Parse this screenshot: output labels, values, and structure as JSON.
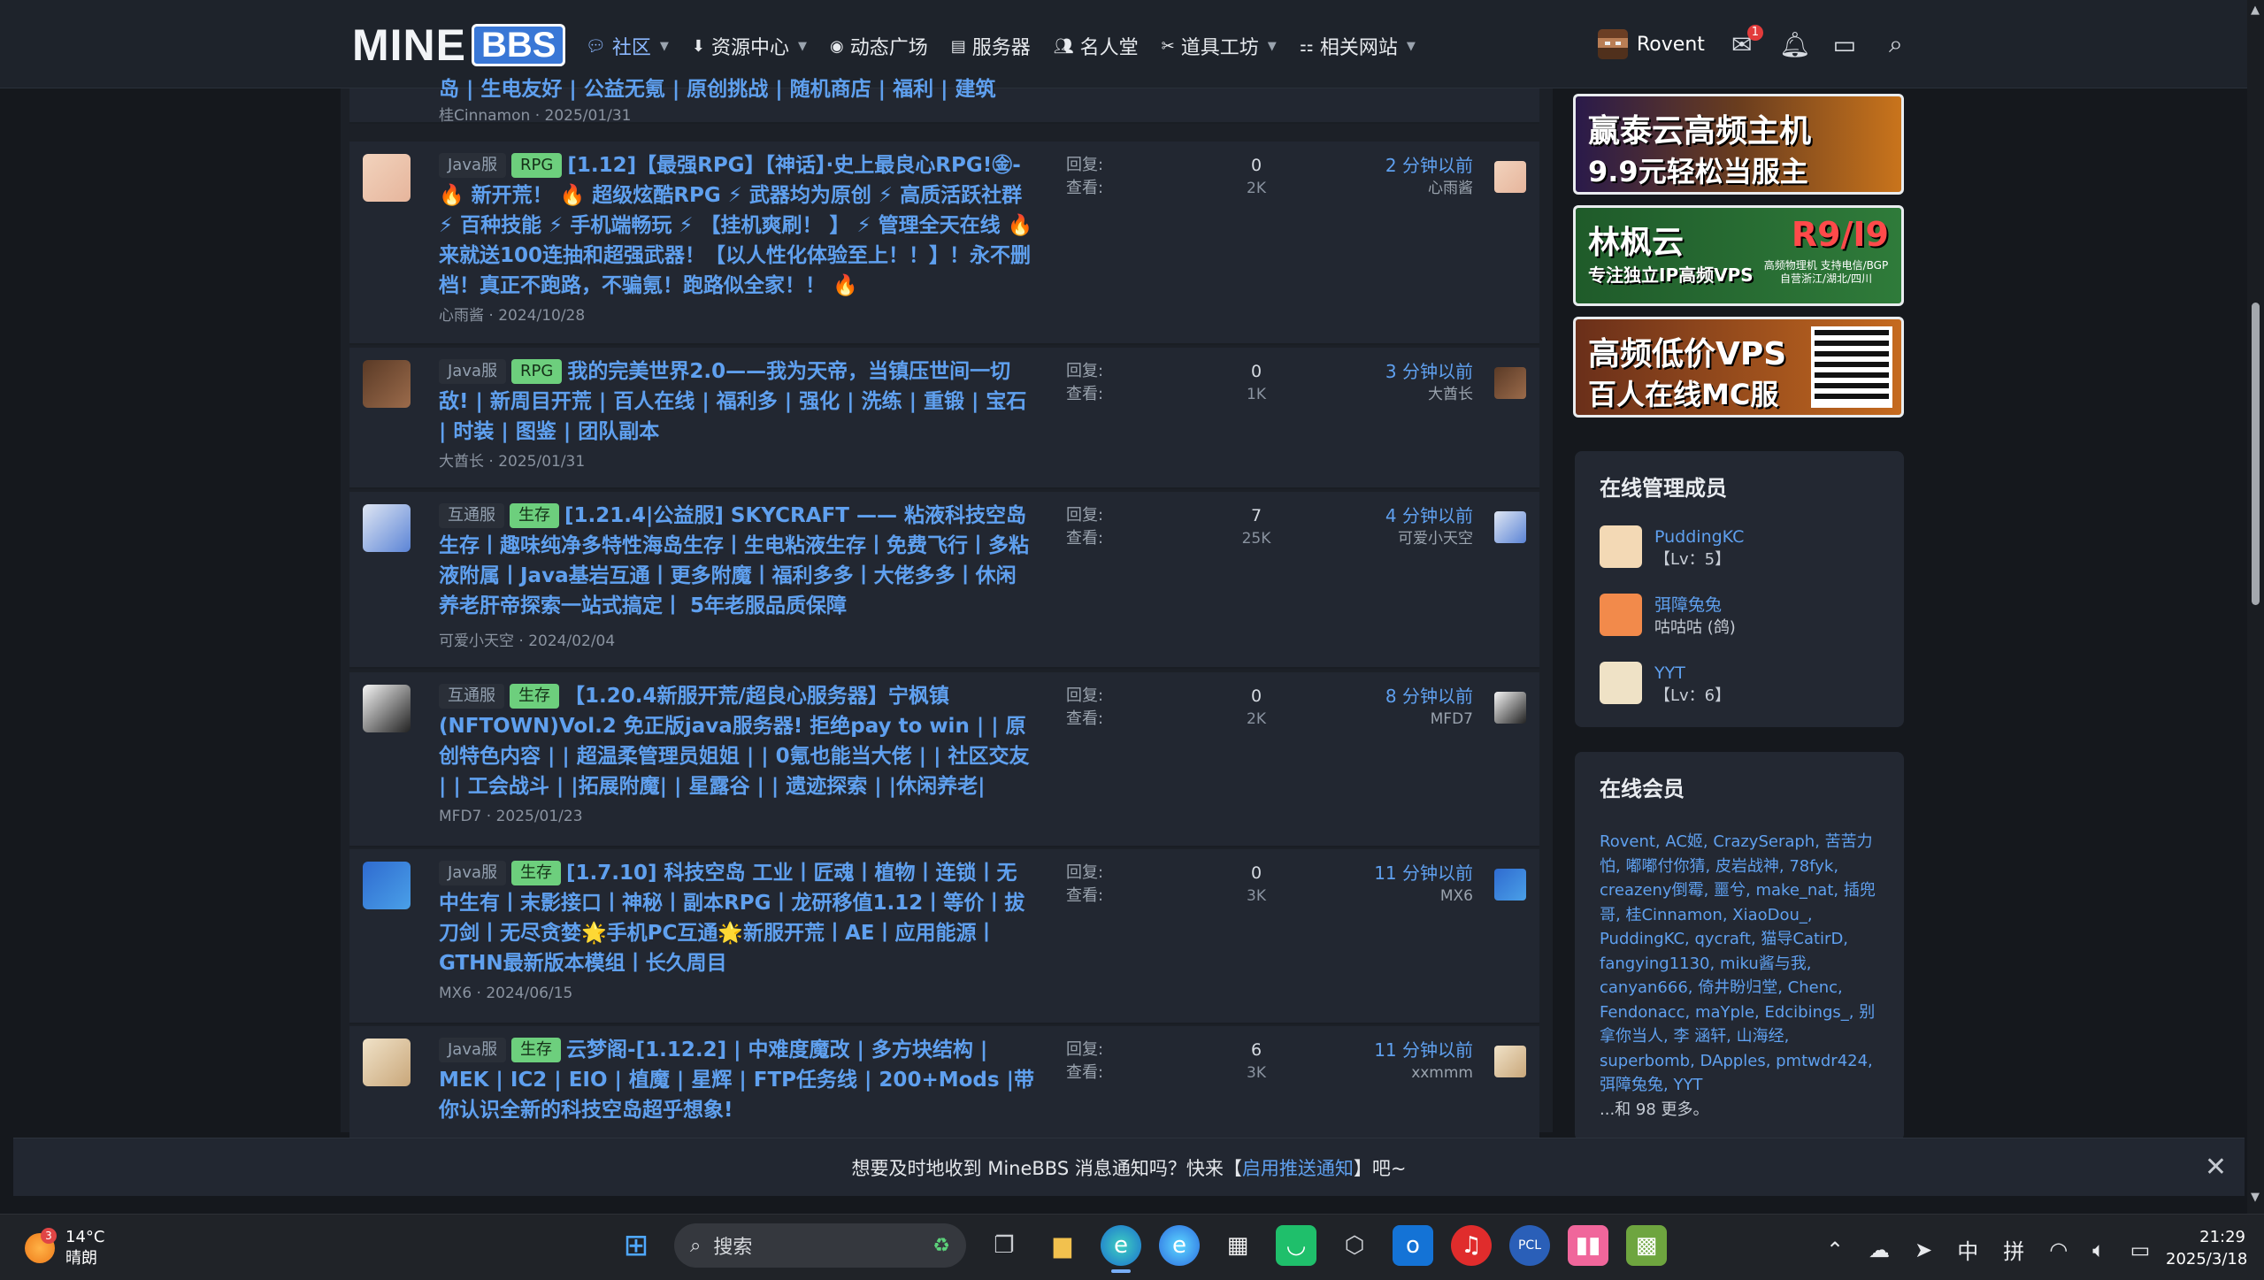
{
  "nav": {
    "logo_a": "MINE",
    "logo_b": "BBS",
    "items": [
      {
        "label": "社区",
        "icon": "chat-icon",
        "caret": true
      },
      {
        "label": "资源中心",
        "icon": "download-icon",
        "caret": true
      },
      {
        "label": "动态广场",
        "icon": "broadcast-icon",
        "caret": false
      },
      {
        "label": "服务器",
        "icon": "server-icon",
        "caret": false
      },
      {
        "label": "名人堂",
        "icon": "people-icon",
        "caret": false
      },
      {
        "label": "道具工坊",
        "icon": "tools-icon",
        "caret": true
      },
      {
        "label": "相关网站",
        "icon": "sitemap-icon",
        "caret": true
      }
    ],
    "user": "Rovent",
    "inbox_badge": "1"
  },
  "partial": {
    "title": "岛 | 生电友好 | 公益无氪 | 原创挑战 | 随机商店 | 福利 | 建筑",
    "meta": "桂Cinnamon · 2025/01/31"
  },
  "labels": {
    "reply": "回复:",
    "view": "查看:"
  },
  "threads": [
    {
      "tags": [
        {
          "t": "Java服",
          "c": "g"
        },
        {
          "t": "RPG",
          "c": "r"
        }
      ],
      "title": "[1.12]【最强RPG】【神话】·史上最良心RPG!㊎- 🔥 新开荒！ 🔥 超级炫酷RPG ⚡ 武器均为原创 ⚡ 高质活跃社群 ⚡ 百种技能 ⚡ 手机端畅玩 ⚡ 【挂机爽刷！ 】 ⚡ 管理全天在线 🔥 来就送100连抽和超强武器！【以人性化体验至上！！】！永不删档！真正不跑路，不骗氪！跑路似全家！！ 🔥",
      "meta": "心雨酱 · 2024/10/28",
      "replies": "0",
      "views": "2K",
      "time": "2 分钟以前",
      "last": "心雨酱"
    },
    {
      "tags": [
        {
          "t": "Java服",
          "c": "g"
        },
        {
          "t": "RPG",
          "c": "r"
        }
      ],
      "title": "我的完美世界2.0——我为天帝，当镇压世间一切敌! | 新周目开荒 | 百人在线 | 福利多 | 强化 | 洗练 | 重锻 | 宝石 | 时装 | 图鉴 | 团队副本",
      "meta": "大酋长 · 2025/01/31",
      "replies": "0",
      "views": "1K",
      "time": "3 分钟以前",
      "last": "大酋长"
    },
    {
      "tags": [
        {
          "t": "互通服",
          "c": "g"
        },
        {
          "t": "生存",
          "c": "r"
        }
      ],
      "title": "[1.21.4|公益服] SKYCRAFT —— 粘液科技空岛生存丨趣味纯净多特性海岛生存丨生电粘液生存丨免费飞行丨多粘液附属丨Java基岩互通丨更多附魔丨福利多多丨大佬多多丨休闲养老肝帝探索一站式搞定丨 5年老服品质保障",
      "meta": "可爱小天空 · 2024/02/04",
      "replies": "7",
      "views": "25K",
      "time": "4 分钟以前",
      "last": "可爱小天空"
    },
    {
      "tags": [
        {
          "t": "互通服",
          "c": "g"
        },
        {
          "t": "生存",
          "c": "r"
        }
      ],
      "title": "【1.20.4新服开荒/超良心服务器】宁枫镇(NFTOWN)Vol.2 免正版java服务器! 拒绝pay to win | | 原创特色内容 | | 超温柔管理员姐姐 | | 0氪也能当大佬 | | 社区交友 | | 工会战斗 | |拓展附魔| | 星露谷 | | 遗迹探索 | |休闲养老|",
      "meta": "MFD7 · 2025/01/23",
      "replies": "0",
      "views": "2K",
      "time": "8 分钟以前",
      "last": "MFD7"
    },
    {
      "tags": [
        {
          "t": "Java服",
          "c": "g"
        },
        {
          "t": "生存",
          "c": "r"
        }
      ],
      "title": "[1.7.10] 科技空岛 工业丨匠魂丨植物丨连锁丨无中生有丨末影接口丨神秘丨副本RPG丨龙研移值1.12丨等价丨拔刀剑丨无尽贪婪🌟手机PC互通🌟新服开荒丨AE丨应用能源丨GTHN最新版本模组丨长久周目",
      "meta": "MX6 · 2024/06/15",
      "replies": "0",
      "views": "3K",
      "time": "11 分钟以前",
      "last": "MX6"
    },
    {
      "tags": [
        {
          "t": "Java服",
          "c": "g"
        },
        {
          "t": "生存",
          "c": "r"
        }
      ],
      "title": "云梦阁-[1.12.2] | 中难度魔改 | 多方块结构 | MEK | IC2 | EIO | 植魔 | 星辉 | FTP任务线 | 200+Mods |带你认识全新的科技空岛超乎想象!",
      "meta": "",
      "replies": "6",
      "views": "3K",
      "time": "11 分钟以前",
      "last": "xxmmm"
    }
  ],
  "ads": [
    {
      "l1": "赢泰云高频主机",
      "l2": "9.9元轻松当服主"
    },
    {
      "l1": "林枫云",
      "l2": "专注独立IP高频VPS",
      "r1": "R9/I9",
      "r2": "高频物理机 支持电信/BGP 自营浙江/湖北/四川"
    },
    {
      "l1": "高频低价VPS",
      "l2": "百人在线MC服"
    }
  ],
  "staff": {
    "title": "在线管理成员",
    "members": [
      {
        "name": "PuddingKC",
        "sub": "【Lv：5】"
      },
      {
        "name": "弭障兔兔",
        "sub": "咕咕咕 (鸽)"
      },
      {
        "name": "YYT",
        "sub": "【Lv：6】"
      }
    ]
  },
  "online": {
    "title": "在线会员",
    "list": "Rovent, AC姬, CrazySeraph, 苦苦力怕, 嘟嘟付你猜, 皮岩战神, 78fyk, creazeny倒霉, 噩兮, make_nat, 插兜哥, 桂Cinnamon, XiaoDou_, PuddingKC, qycraft, 猫导CatirD, fangying1130, miku酱与我, canyan666, 倚井盼归堂, Chenc, Fendonacc, maYple, Edcibings_, 别拿你当人, 李 涵轩, 山海经, superbomb, DApples, pmtwdr424, 弭障兔兔, YYT",
    "more": "...和 98 更多。"
  },
  "notice": {
    "a": "想要及时地收到 MineBBS 消息通知吗？快来【",
    "link": "启用推送通知",
    "b": "】吧~"
  },
  "taskbar": {
    "temp": "14°C",
    "weather": "晴朗",
    "wbadge": "3",
    "search": "搜索",
    "ime1": "中",
    "ime2": "拼",
    "time": "21:29",
    "date": "2025/3/18"
  },
  "colors": {
    "accent": "#5fa0ef",
    "tag_green": "#6dcf7d",
    "bg": "#15181d"
  }
}
